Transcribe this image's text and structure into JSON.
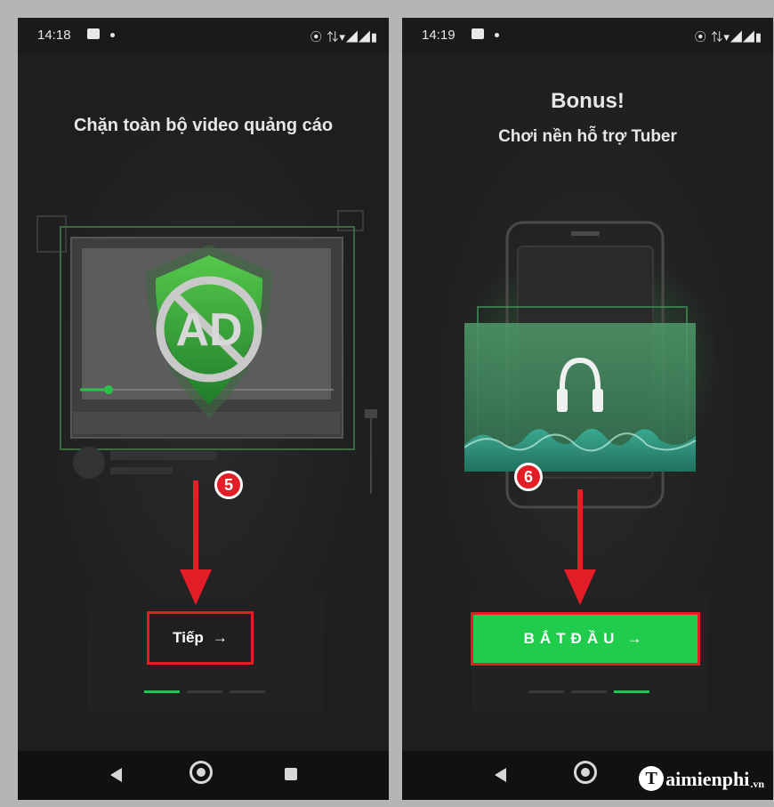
{
  "left_screen": {
    "status": {
      "time": "14:18",
      "sys_icons": "⦿ ⇅▾◢◢▮"
    },
    "title": "Chặn toàn bộ video quảng cáo",
    "illustration_text": "AD",
    "next_button_label": "Tiếp",
    "next_arrow": "→",
    "step_number": "5",
    "page_dots_active_index": 0
  },
  "right_screen": {
    "status": {
      "time": "14:19",
      "sys_icons": "⦿ ⇅▾◢◢▮"
    },
    "title": "Bonus!",
    "subtitle": "Chơi nền hỗ trợ Tuber",
    "start_button_label": "BẮTĐẦU",
    "start_arrow": "→",
    "step_number": "6",
    "page_dots_active_index": 2
  },
  "watermark": {
    "brand": "aimienphi",
    "letter": "T",
    "suffix": ".vn"
  },
  "colors": {
    "accent_green": "#1fcc4c",
    "highlight_red": "#e41e26"
  }
}
